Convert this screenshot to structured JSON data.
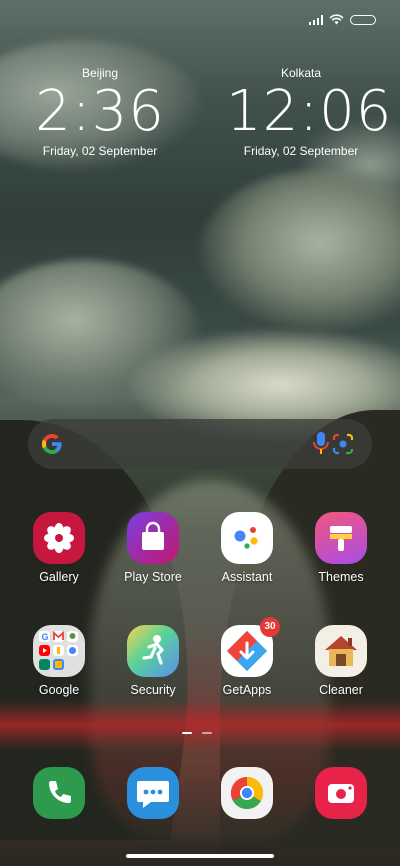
{
  "clocks": [
    {
      "city": "Beijing",
      "time": "2:36",
      "date": "Friday, 02 September"
    },
    {
      "city": "Kolkata",
      "time": "12:06",
      "date": "Friday, 02 September"
    }
  ],
  "apps": [
    {
      "label": "Gallery",
      "icon": "gallery-flower-icon"
    },
    {
      "label": "Play Store",
      "icon": "shopping-bag-icon"
    },
    {
      "label": "Assistant",
      "icon": "assistant-dots-icon"
    },
    {
      "label": "Themes",
      "icon": "paint-brush-icon"
    },
    {
      "label": "Google",
      "icon": "google-folder-icon"
    },
    {
      "label": "Security",
      "icon": "security-runner-icon"
    },
    {
      "label": "GetApps",
      "icon": "getapps-icon",
      "badge": "30"
    },
    {
      "label": "Cleaner",
      "icon": "cleaner-house-icon"
    }
  ],
  "dock": [
    {
      "icon": "phone-icon"
    },
    {
      "icon": "messages-icon"
    },
    {
      "icon": "chrome-icon"
    },
    {
      "icon": "camera-icon"
    }
  ],
  "colors": {
    "gallery": "#c8173f",
    "security_badge": "#e53935"
  }
}
